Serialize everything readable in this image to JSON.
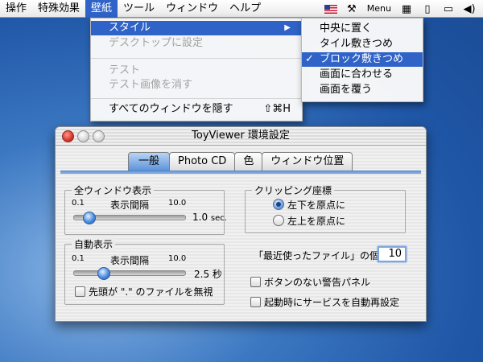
{
  "menubar": {
    "items": [
      "操作",
      "特殊効果",
      "壁紙",
      "ツール",
      "ウィンドウ",
      "ヘルプ"
    ],
    "active_index": 2,
    "right_text": "Menu",
    "right_icons": [
      "us-flag-icon",
      "tools-icon",
      "menu-extra-icon",
      "script-icon",
      "document-icon",
      "display-icon",
      "volume-icon"
    ]
  },
  "wallpaper_menu": {
    "items": [
      {
        "label": "スタイル",
        "disabled": false,
        "highlighted": true,
        "submenu": true
      },
      {
        "label": "デスクトップに設定",
        "disabled": true
      },
      {
        "label": "テスト",
        "disabled": true
      },
      {
        "label": "テスト画像を消す",
        "disabled": true
      },
      {
        "label": "すべてのウィンドウを隠す",
        "disabled": false,
        "shortcut": "⇧⌘H"
      }
    ]
  },
  "style_menu": {
    "items": [
      {
        "label": "中央に置く",
        "checked": false
      },
      {
        "label": "タイル敷きつめ",
        "checked": false
      },
      {
        "label": "ブロック敷きつめ",
        "checked": true
      },
      {
        "label": "画面に合わせる",
        "checked": false
      },
      {
        "label": "画面を覆う",
        "checked": false
      }
    ],
    "check_mark": "✓"
  },
  "window": {
    "title": "ToyViewer 環境設定",
    "tabs": [
      "一般",
      "Photo CD",
      "色",
      "ウィンドウ位置"
    ],
    "active_tab": 0,
    "all_window_group": {
      "title": "全ウィンドウ表示",
      "min": "0.1",
      "label": "表示間隔",
      "max": "10.0",
      "value": "1.0",
      "unit": "sec.",
      "slider_position": 0.1
    },
    "auto_display_group": {
      "title": "自動表示",
      "min": "0.1",
      "label": "表示間隔",
      "max": "10.0",
      "value": "2.5",
      "unit": "秒",
      "slider_position": 0.24,
      "checkbox_label": "先頭が \".\" のファイルを無視",
      "checkbox_checked": false
    },
    "clipping_group": {
      "title": "クリッピング座標",
      "options": [
        "左下を原点に",
        "左上を原点に"
      ],
      "selected": 0
    },
    "recent_files_label": "「最近使ったファイル」の個数",
    "recent_files_value": "10",
    "alert_panel_label": "ボタンのない警告パネル",
    "alert_panel_checked": false,
    "auto_service_label": "起動時にサービスを自動再設定",
    "auto_service_checked": false
  }
}
